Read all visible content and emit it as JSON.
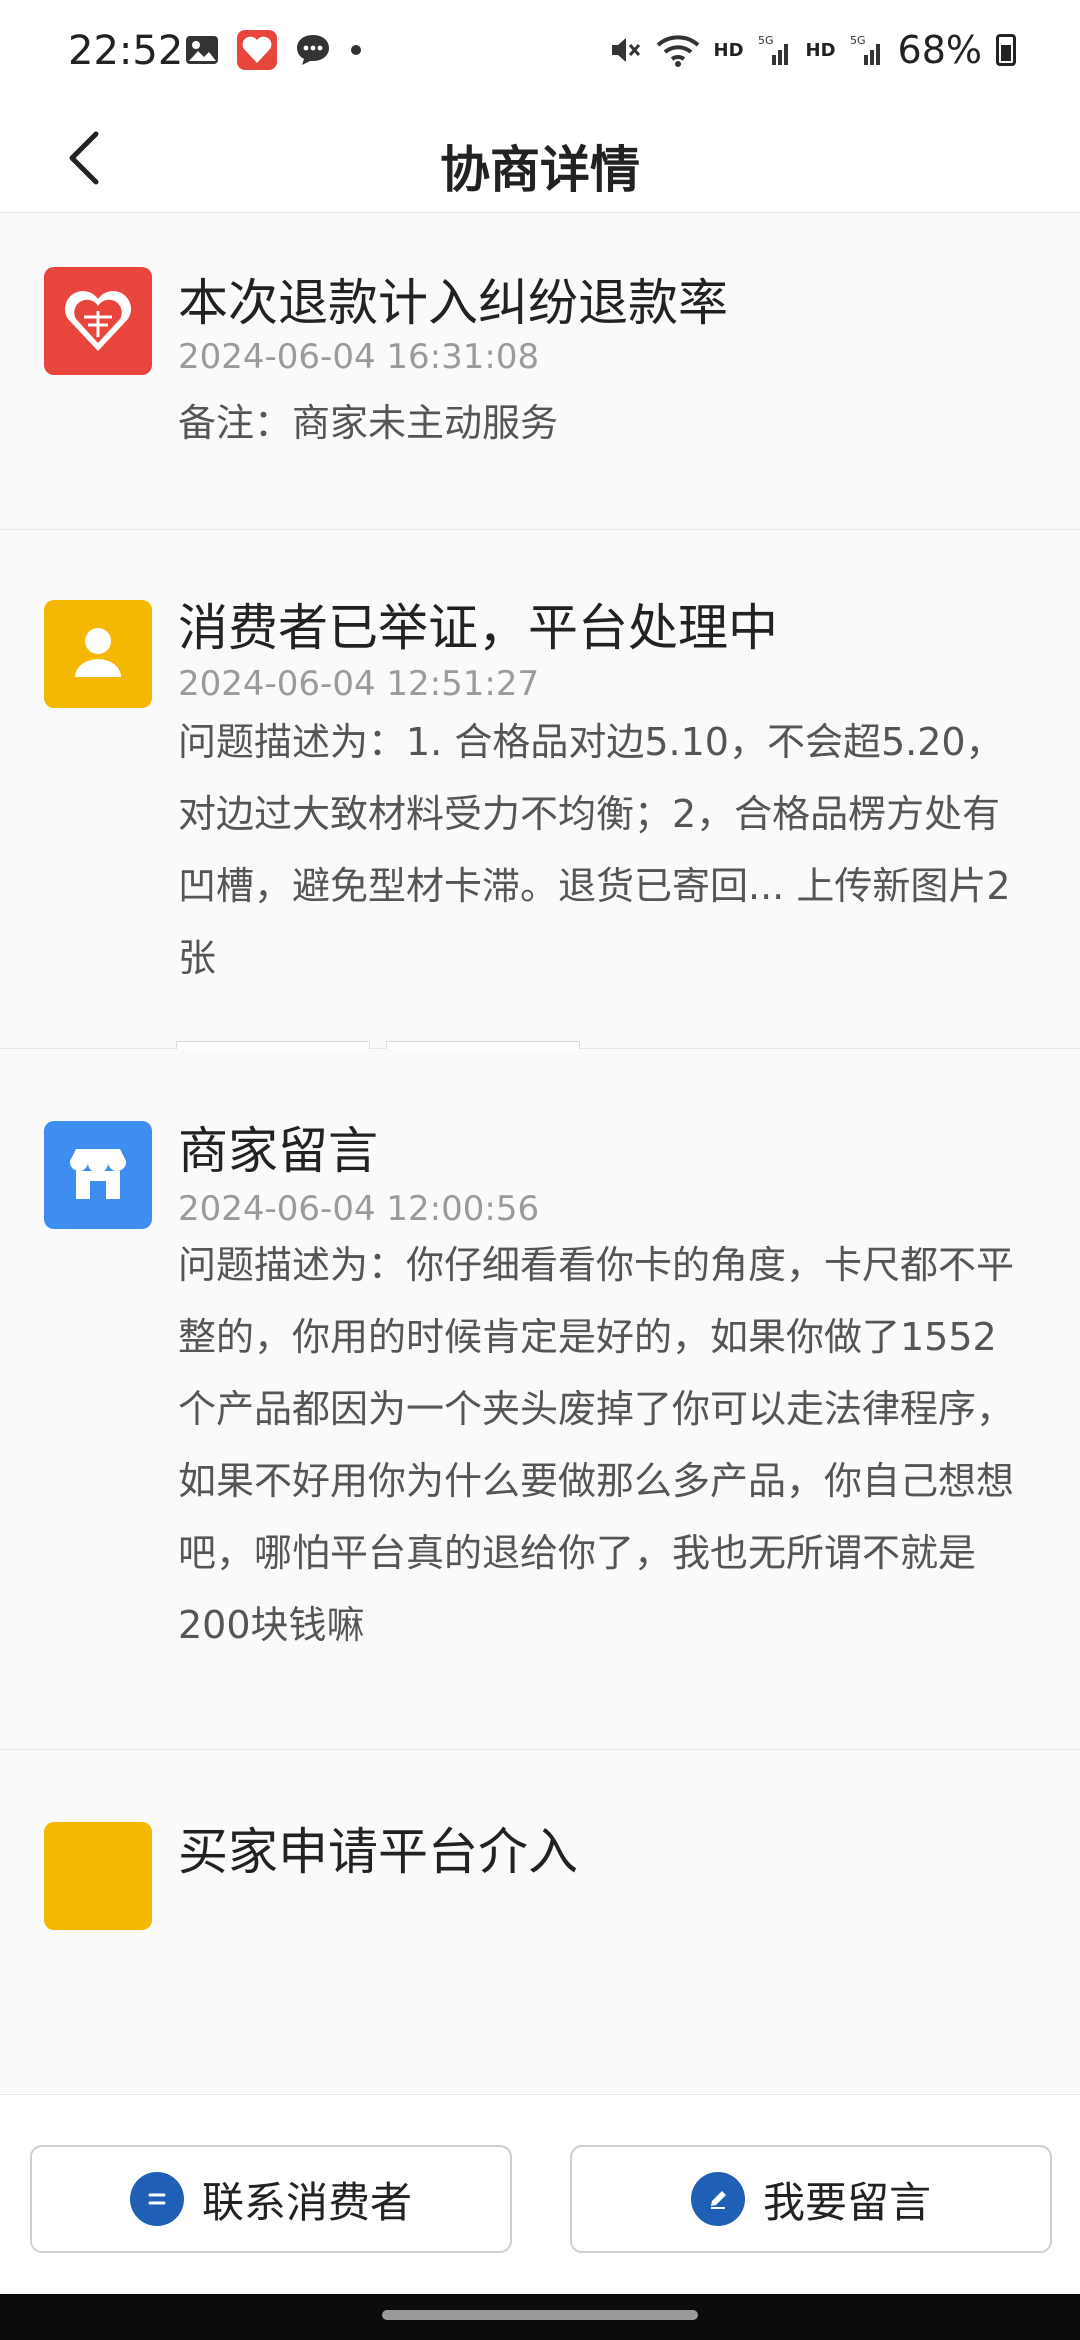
{
  "status_bar": {
    "time": "22:52",
    "hd1": "HD",
    "hd2": "HD",
    "battery": "68%"
  },
  "header": {
    "title": "协商详情"
  },
  "entries": [
    {
      "title": "本次退款计入纠纷退款率",
      "time": "2024-06-04 16:31:08",
      "note": "备注：商家未主动服务",
      "icon": "pinduoduo-logo-icon",
      "color": "#e8453c"
    },
    {
      "title": "消费者已举证，平台处理中",
      "time": "2024-06-04 12:51:27",
      "body": "问题描述为：1. 合格品对边5.10，不会超5.20，对边过大致材料受力不均衡；2，合格品楞方处有凹槽，避免型材卡滞。退货已寄回... 上传新图片2张",
      "icon": "person-icon",
      "color": "#f5b800"
    },
    {
      "title": "商家留言",
      "time": "2024-06-04 12:00:56",
      "body": "问题描述为：你仔细看看你卡的角度，卡尺都不平整的，你用的时候肯定是好的，如果你做了1552个产品都因为一个夹头废掉了你可以走法律程序，如果不好用你为什么要做那么多产品，你自己想想吧，哪怕平台真的退给你了，我也无所谓不就是200块钱嘛",
      "icon": "store-icon",
      "color": "#3d8ef0"
    },
    {
      "title": "买家申请平台介入",
      "icon": "person-icon",
      "color": "#f5b800"
    }
  ],
  "buttons": {
    "contact": "联系消费者",
    "message": "我要留言"
  },
  "colors": {
    "accent_blue": "#1f5fb5"
  }
}
